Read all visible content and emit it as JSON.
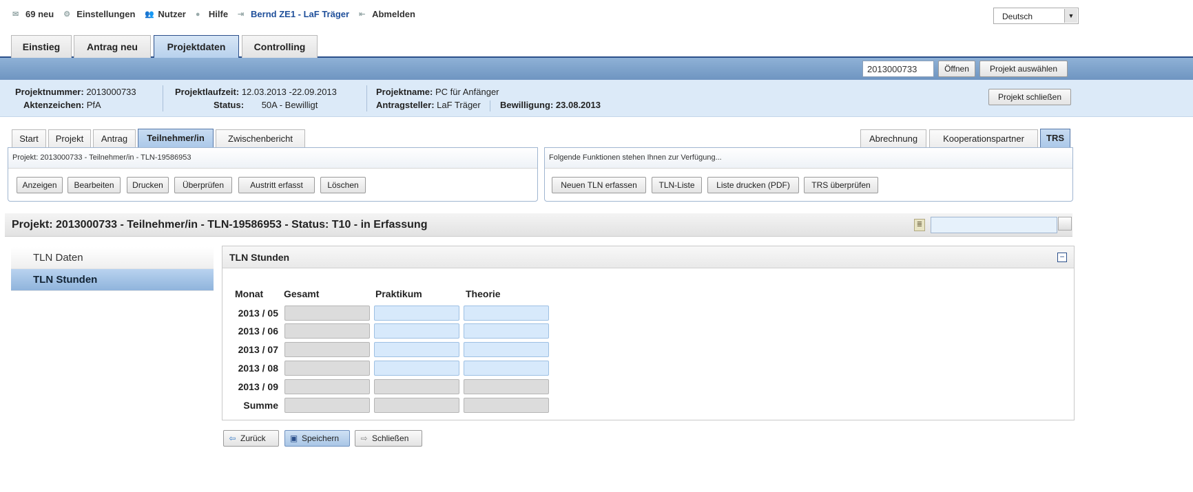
{
  "topbar": {
    "messages": "69 neu",
    "settings": "Einstellungen",
    "users": "Nutzer",
    "help": "Hilfe",
    "user": "Bernd ZE1 - LaF Träger",
    "logout": "Abmelden",
    "language": "Deutsch"
  },
  "main_tabs": [
    "Einstieg",
    "Antrag neu",
    "Projektdaten",
    "Controlling"
  ],
  "bluebar": {
    "project_number_value": "2013000733",
    "open_label": "Öffnen",
    "select_label": "Projekt auswählen"
  },
  "info": {
    "projektnummer_label": "Projektnummer:",
    "projektnummer": "2013000733",
    "aktenzeichen_label": "Aktenzeichen:",
    "aktenzeichen": "PfA",
    "laufzeit_label": "Projektlaufzeit:",
    "laufzeit": "12.03.2013 -22.09.2013",
    "status_label": "Status:",
    "status": "50A - Bewilligt",
    "projektname_label": "Projektname:",
    "projektname": "PC für Anfänger",
    "antragsteller_label": "Antragsteller:",
    "antragsteller": "LaF Träger",
    "bewilligung_label": "Bewilligung:",
    "bewilligung": "23.08.2013",
    "close_label": "Projekt schließen"
  },
  "sub_tabs_left": [
    "Start",
    "Projekt",
    "Antrag",
    "Teilnehmer/in",
    "Zwischenbericht"
  ],
  "sub_tabs_right": [
    "Abrechnung",
    "Kooperationspartner",
    "TRS"
  ],
  "left_panel": {
    "header": "Projekt: 2013000733 - Teilnehmer/in - TLN-19586953",
    "buttons": [
      "Anzeigen",
      "Bearbeiten",
      "Drucken",
      "Überprüfen",
      "Austritt erfasst",
      "Löschen"
    ]
  },
  "right_panel": {
    "header": "Folgende Funktionen stehen Ihnen zur Verfügung...",
    "buttons": [
      "Neuen TLN erfassen",
      "TLN-Liste",
      "Liste drucken (PDF)",
      "TRS überprüfen"
    ]
  },
  "page_title": "Projekt: 2013000733 - Teilnehmer/in - TLN-19586953 - Status: T10 - in Erfassung",
  "left_nav": [
    "TLN Daten",
    "TLN Stunden"
  ],
  "section_title": "TLN Stunden",
  "table": {
    "headers": [
      "Monat",
      "Gesamt",
      "Praktikum",
      "Theorie"
    ],
    "rows": [
      "2013 / 05",
      "2013 / 06",
      "2013 / 07",
      "2013 / 08",
      "2013 / 09",
      "Summe"
    ]
  },
  "bottom_buttons": [
    "Zurück",
    "Speichern",
    "Schließen"
  ]
}
